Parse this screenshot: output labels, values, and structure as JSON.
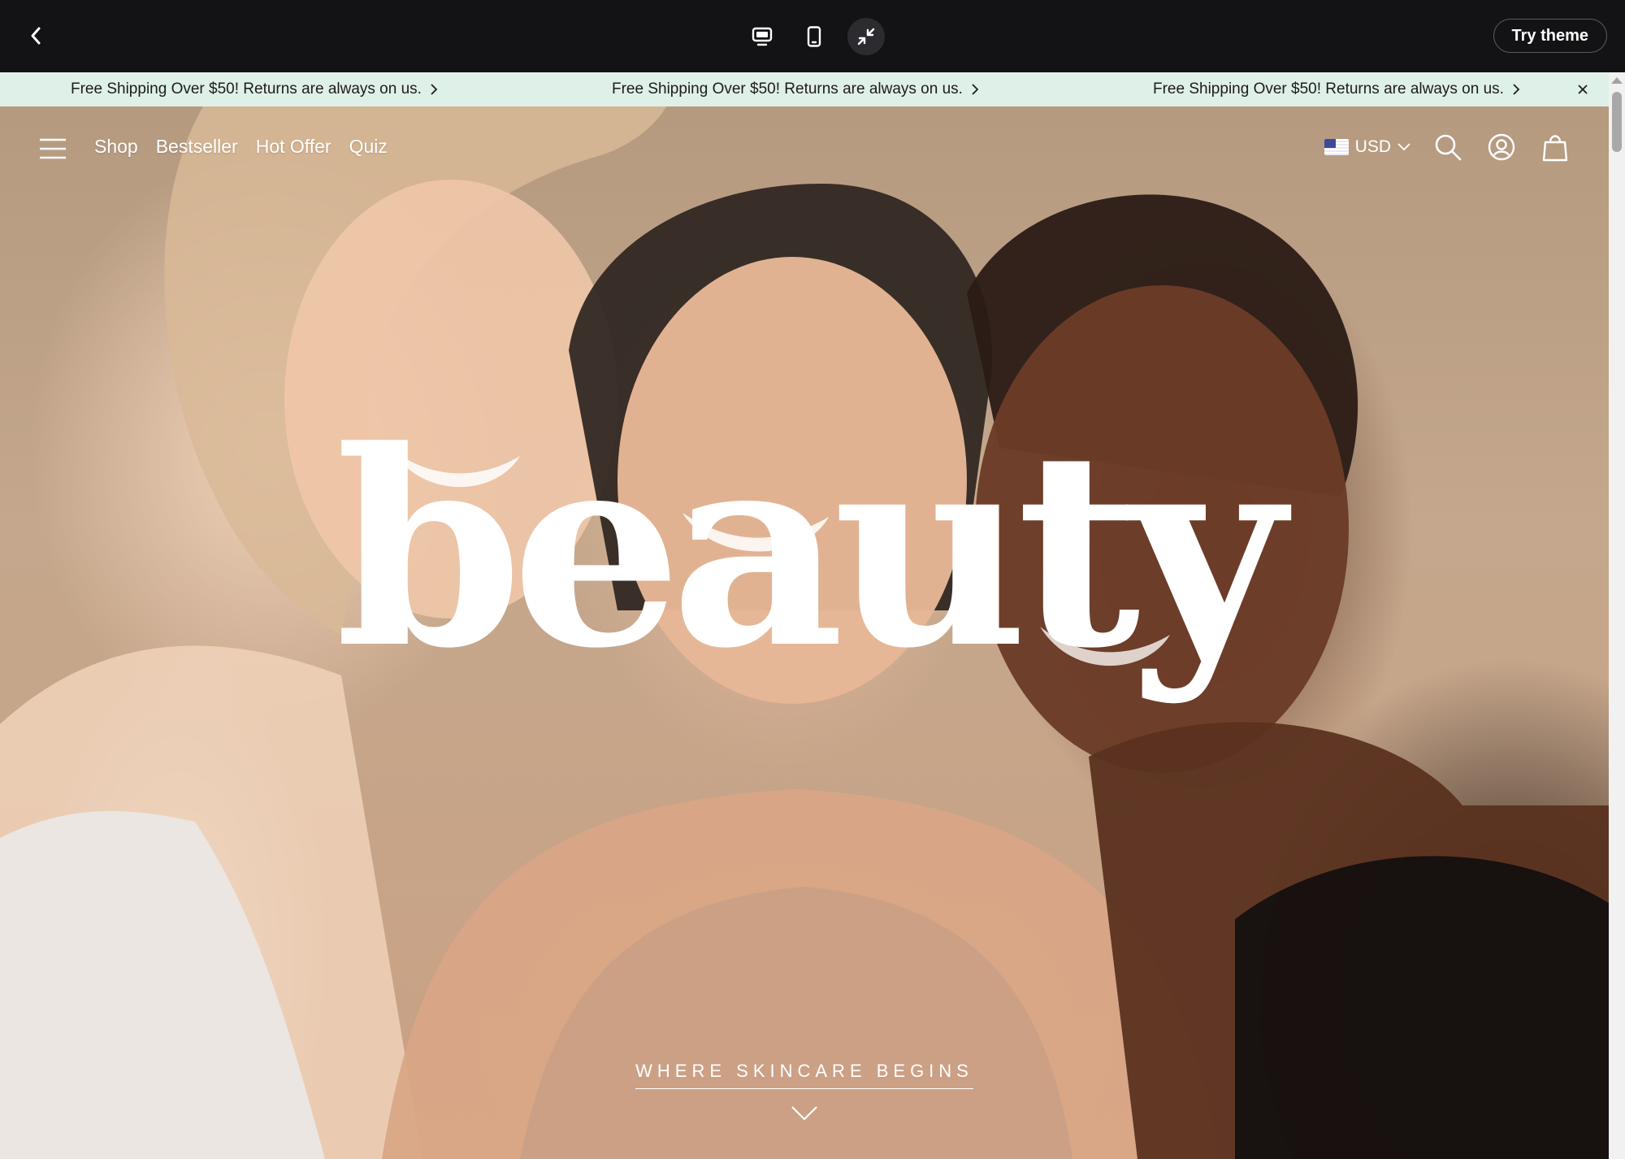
{
  "preview_bar": {
    "back_icon": "chevron-left-icon",
    "devices": [
      {
        "icon": "desktop-icon",
        "active": false
      },
      {
        "icon": "mobile-icon",
        "active": false
      },
      {
        "icon": "collapse-icon",
        "active": true
      }
    ],
    "try_label": "Try theme"
  },
  "announcement": {
    "items": [
      "Free Shipping Over $50! Returns are always on us.",
      "Free Shipping Over $50! Returns are always on us.",
      "Free Shipping Over $50! Returns are always on us."
    ],
    "close_icon": "close-icon",
    "background": "#dff0e8"
  },
  "nav": {
    "menu_icon": "hamburger-menu-icon",
    "links": [
      "Shop",
      "Bestseller",
      "Hot Offer",
      "Quiz"
    ],
    "currency": "USD",
    "flag_icon": "us-flag-icon",
    "icons": [
      "search-icon",
      "account-icon",
      "bag-icon"
    ]
  },
  "hero": {
    "headline": "beauty",
    "cta_label": "WHERE SKINCARE BEGINS",
    "cta_icon": "chevron-down-icon"
  }
}
